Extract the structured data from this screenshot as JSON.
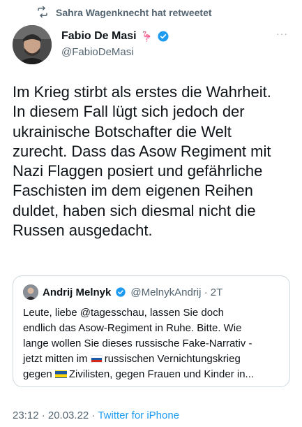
{
  "retweet": {
    "label": "Sahra Wagenknecht hat retweetet",
    "icon": "retweet-icon"
  },
  "author": {
    "name": "Fabio De Masi",
    "emoji": "🦩",
    "handle": "@FabioDeMasi",
    "verified": true,
    "more_label": "···"
  },
  "tweet": {
    "lines": [
      "Im Krieg stirbt als erstes die Wahrheit.",
      "In diesem Fall lügt sich jedoch der",
      "ukrainische Botschafter die Welt",
      "zurecht. Dass das Asow Regiment mit",
      "Nazi Flaggen posiert und gefährliche",
      "Faschisten im dem eigenen Reihen",
      "duldet, haben sich diesmal nicht die",
      "Russen ausgedacht."
    ]
  },
  "quote": {
    "name": "Andrij Melnyk",
    "verified": true,
    "handle_time": "@MelnykAndrij · 2T",
    "lines": {
      "l1": "Leute, liebe @tagesschau, lassen Sie doch",
      "l2": "endlich das Asow-Regiment in Ruhe. Bitte. Wie",
      "l3": "lange wollen Sie dieses russische Fake-Narrativ -",
      "l4a": "jetzt mitten im ",
      "l4b": "russischen Vernichtungskrieg",
      "l5a": "gegen ",
      "l5b": "Zivilisten, gegen Frauen und Kinder in..."
    },
    "flags": [
      "russia-flag",
      "ukraine-flag"
    ]
  },
  "footer": {
    "time_date": "23:12 · 20.03.22 · ",
    "source": "Twitter for iPhone"
  },
  "colors": {
    "accent": "#1d9bf0",
    "muted": "#536471",
    "text": "#0f1419",
    "border": "#cfd9de"
  }
}
